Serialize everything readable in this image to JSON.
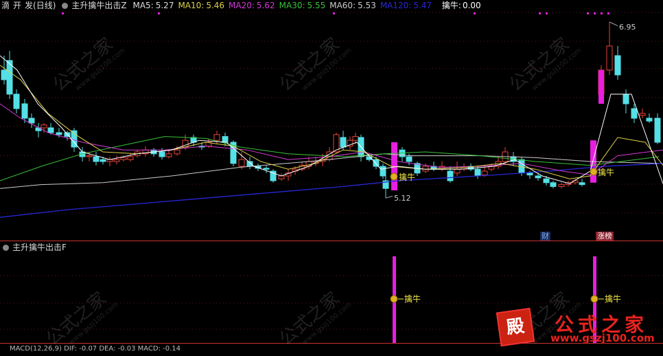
{
  "header": {
    "stock_name": "滴",
    "action_kai": "开",
    "action_fa": "发",
    "period": "(日线)",
    "indicator_name": "主升擒牛出击Z",
    "ma": [
      {
        "label": "MA5:",
        "value": "5.27",
        "color": "#dddddd"
      },
      {
        "label": "MA10:",
        "value": "5.46",
        "color": "#e0d24a"
      },
      {
        "label": "MA20:",
        "value": "5.62",
        "color": "#d23ad6"
      },
      {
        "label": "MA30:",
        "value": "5.55",
        "color": "#39c239"
      },
      {
        "label": "MA60:",
        "value": "5.53",
        "color": "#cccccc"
      },
      {
        "label": "MA120:",
        "value": "5.47",
        "color": "#2727d8"
      }
    ],
    "qinniu_label": "擒牛:",
    "qinniu_value": "0.00"
  },
  "main_chart": {
    "high_label": "6.95",
    "low_label": "5.12",
    "signal_label_1": "擒牛",
    "signal_label_2": "擒牛",
    "badge_cai": "财",
    "badge_zhangbang": "涨榜",
    "colors": {
      "up": "#e8433a",
      "down": "#54e0e6",
      "signal_bar": "#e81ee0"
    }
  },
  "sub_panel": {
    "title": "主升擒牛出击F",
    "signal_1": "擒牛",
    "signal_2": "擒牛"
  },
  "bottom_panel": {
    "text": "MACD(12,26,9)  DIF: -0.07  DEA: -0.03  MACD: -0.14"
  },
  "watermark": {
    "text": "公式之家",
    "url": "www.gszj100.com"
  },
  "logo": {
    "seal": "殿",
    "text": "公式之家",
    "url": "www.gszj100.com"
  }
}
